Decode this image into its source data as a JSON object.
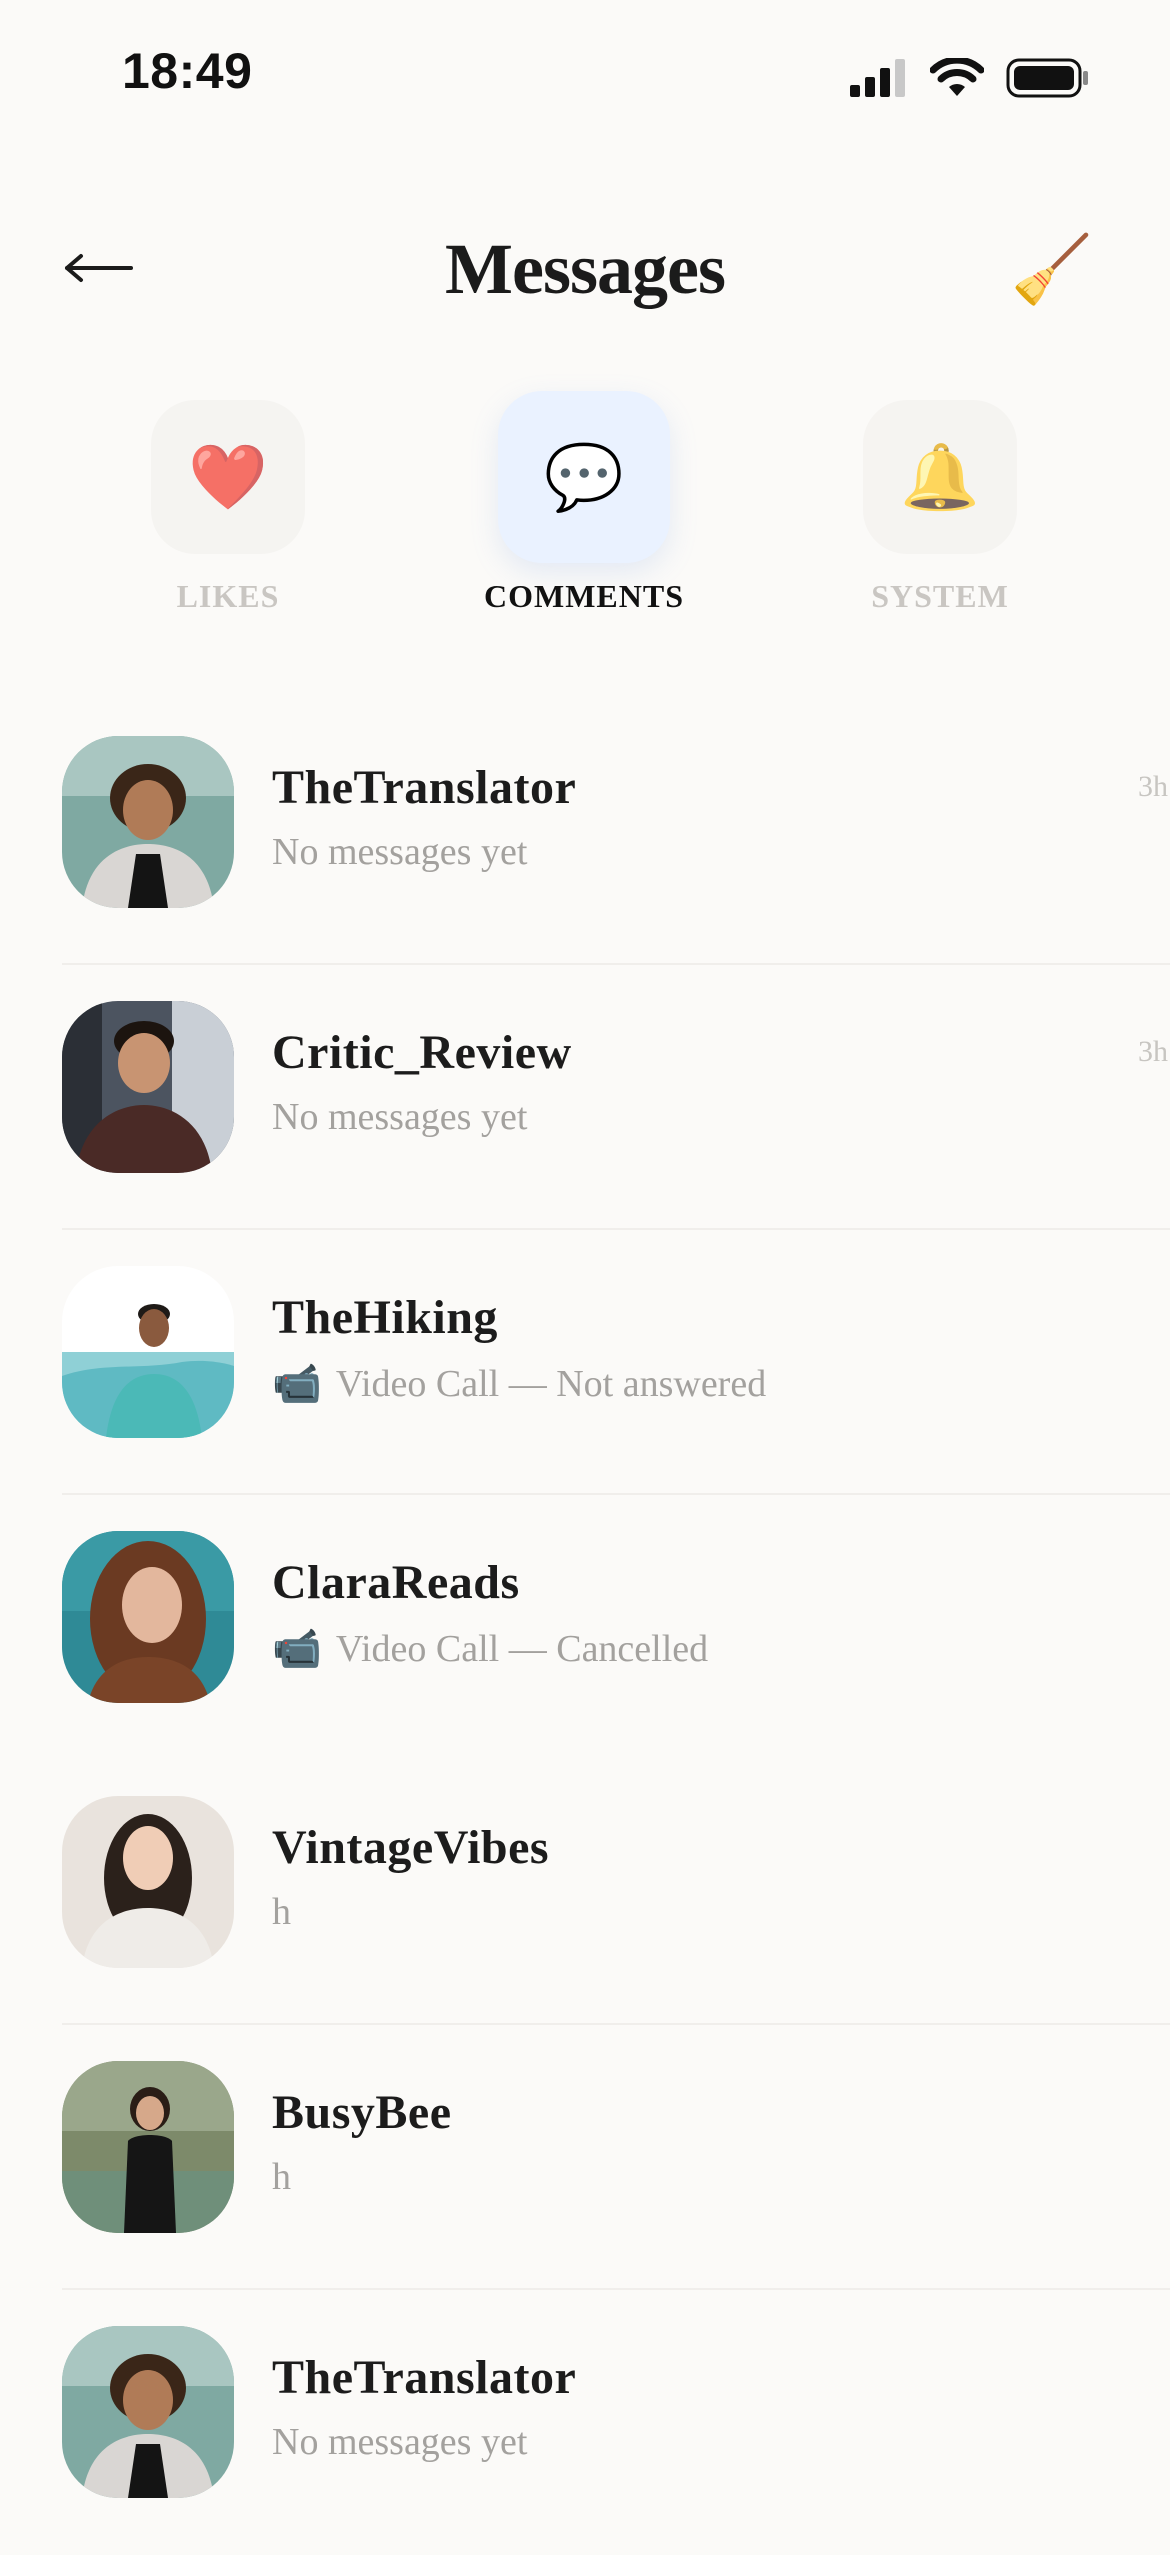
{
  "status_bar": {
    "time": "18:49",
    "icons": [
      "cellular-signal-icon",
      "wifi-icon",
      "battery-icon"
    ]
  },
  "header": {
    "title": "Messages",
    "back_icon": "arrow-left-icon",
    "clear_icon": "broom-icon",
    "clear_glyph": "🧹"
  },
  "tabs": [
    {
      "label": "LIKES",
      "icon": "heart-icon",
      "glyph": "❤️",
      "active": false
    },
    {
      "label": "COMMENTS",
      "icon": "speech-bubble-icon",
      "glyph": "💬",
      "active": true
    },
    {
      "label": "SYSTEM",
      "icon": "bell-icon",
      "glyph": "🔔",
      "active": false
    }
  ],
  "messages": [
    {
      "username": "TheTranslator",
      "preview": "No messages yet",
      "time": "3h",
      "preview_icon": ""
    },
    {
      "username": "Critic_Review",
      "preview": "No messages yet",
      "time": "3h",
      "preview_icon": ""
    },
    {
      "username": "TheHiking",
      "preview": "Video Call — Not answered",
      "time": "",
      "preview_icon": "📹"
    },
    {
      "username": "ClaraReads",
      "preview": "Video Call — Cancelled",
      "time": "",
      "preview_icon": "📹"
    },
    {
      "username": "VintageVibes",
      "preview": "h",
      "time": "",
      "preview_icon": ""
    },
    {
      "username": "BusyBee",
      "preview": "h",
      "time": "",
      "preview_icon": ""
    },
    {
      "username": "TheTranslator",
      "preview": "No messages yet",
      "time": "",
      "preview_icon": ""
    }
  ],
  "colors": {
    "background": "#fbfaf8",
    "active_tab_bg": "#eaf2ff",
    "muted_text": "#a3a19e",
    "inactive_tab_label": "#c9c6c2"
  }
}
